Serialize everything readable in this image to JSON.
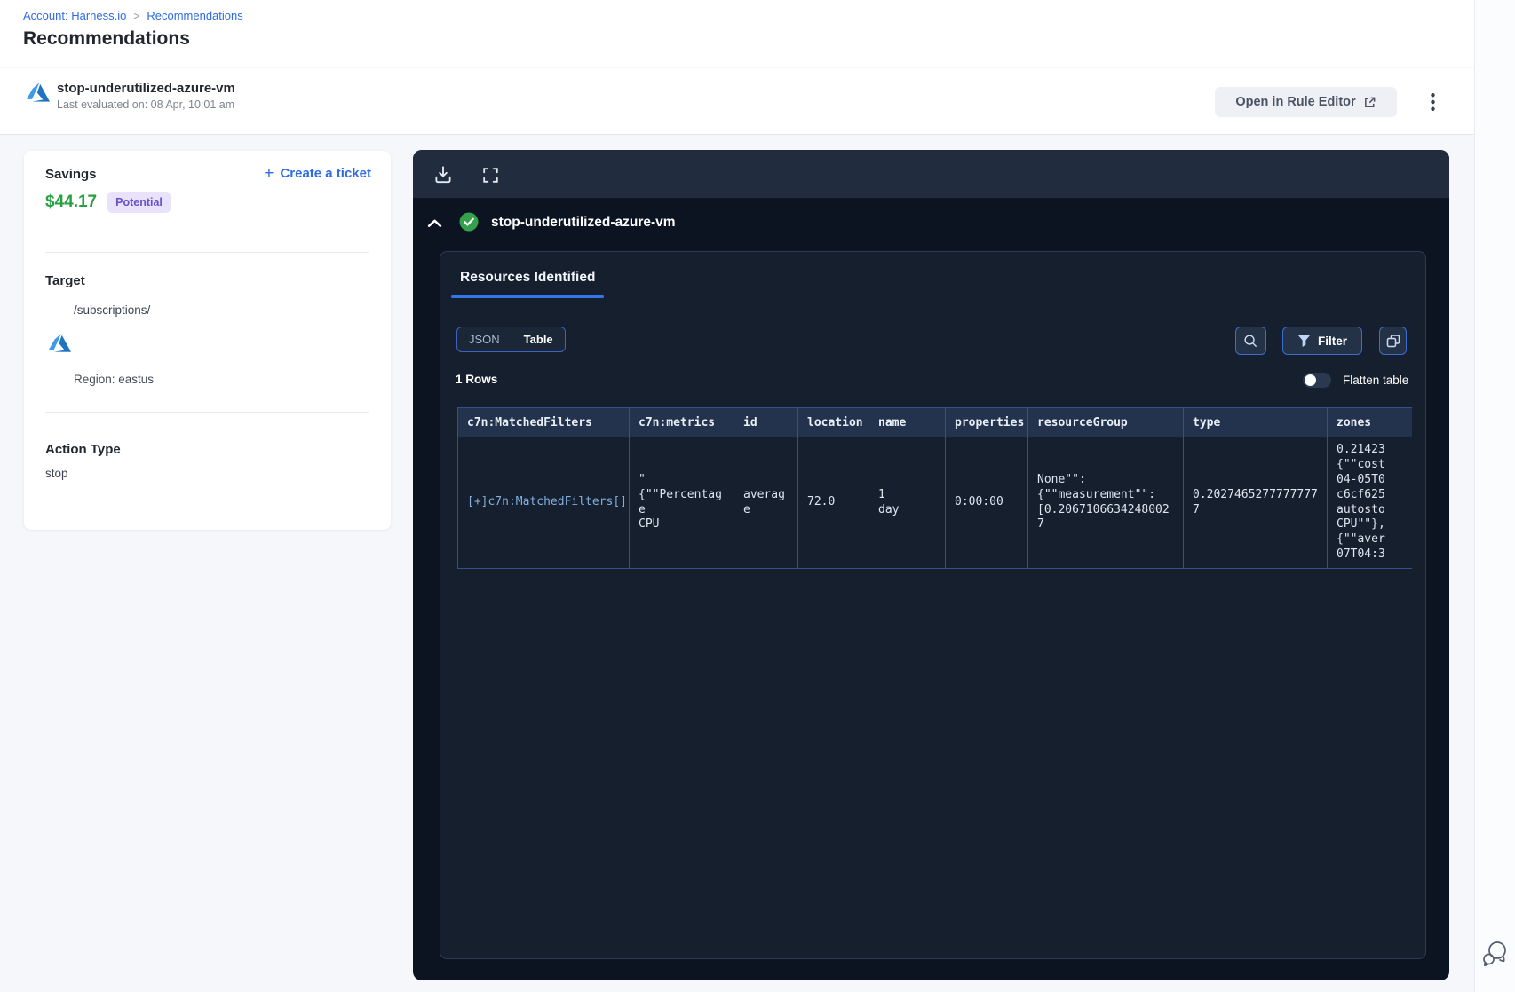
{
  "breadcrumb": {
    "account": "Account: Harness.io",
    "separator": ">",
    "page": "Recommendations"
  },
  "page": {
    "title": "Recommendations"
  },
  "recommendation_header": {
    "name": "stop-underutilized-azure-vm",
    "last_evaluated": "Last evaluated on: 08 Apr, 10:01 am",
    "open_in_rule_editor_label": "Open in Rule Editor"
  },
  "details_card": {
    "savings_label": "Savings",
    "savings_amount": "$44.17",
    "savings_badge": "Potential",
    "create_ticket_label": "Create a ticket",
    "create_ticket_plus": "+",
    "target_label": "Target",
    "target_path": "/subscriptions/",
    "region": "Region: eastus",
    "action_type_label": "Action Type",
    "action_type_value": "stop"
  },
  "panel": {
    "title": "stop-underutilized-azure-vm",
    "tab_label": "Resources Identified",
    "view_json_label": "JSON",
    "view_table_label": "Table",
    "selected_view": "Table",
    "filter_label": "Filter",
    "rows_count": "1 Rows",
    "flatten_label": "Flatten table",
    "flatten_enabled": false,
    "table": {
      "columns": [
        "c7n:MatchedFilters",
        "c7n:metrics",
        "id",
        "location",
        "name",
        "properties",
        "resourceGroup",
        "type",
        "zones"
      ],
      "row": [
        "[+]c7n:MatchedFilters[]",
        "\"\n{\"\"Percentage\nCPU",
        "average",
        "72.0",
        "1\nday",
        "0:00:00",
        "None\"\":\n{\"\"measurement\"\":\n[0.20671066342480027",
        "0.20274652777777777",
        "0.21423\n{\"\"cost\n04-05T0\nc6cf625\nautosto\nCPU\"\"},\n{\"\"aver\n07T04:3"
      ]
    }
  },
  "colors": {
    "accent_blue": "#2f6be4",
    "savings_green": "#27a243",
    "badge_bg": "#e8e3fb",
    "badge_text": "#6650c9",
    "panel_bg": "#0c1422",
    "panel_band_bg": "#222c3f",
    "card_bg": "#151f2e",
    "table_border": "#33518f",
    "tab_underline": "#3376e8",
    "check_green": "#35a14c"
  }
}
